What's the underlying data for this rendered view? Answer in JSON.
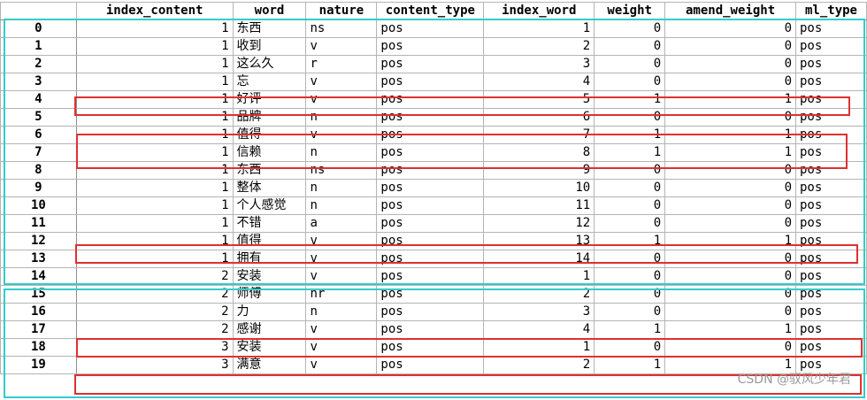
{
  "columns": [
    "index_content",
    "word",
    "nature",
    "content_type",
    "index_word",
    "weight",
    "amend_weight",
    "ml_type"
  ],
  "rows": [
    {
      "idx": "0",
      "index_content": "1",
      "word": "东西",
      "nature": "ns",
      "content_type": "pos",
      "index_word": "1",
      "weight": "0",
      "amend_weight": "0",
      "ml_type": "pos"
    },
    {
      "idx": "1",
      "index_content": "1",
      "word": "收到",
      "nature": "v",
      "content_type": "pos",
      "index_word": "2",
      "weight": "0",
      "amend_weight": "0",
      "ml_type": "pos"
    },
    {
      "idx": "2",
      "index_content": "1",
      "word": "这么久",
      "nature": "r",
      "content_type": "pos",
      "index_word": "3",
      "weight": "0",
      "amend_weight": "0",
      "ml_type": "pos"
    },
    {
      "idx": "3",
      "index_content": "1",
      "word": "忘",
      "nature": "v",
      "content_type": "pos",
      "index_word": "4",
      "weight": "0",
      "amend_weight": "0",
      "ml_type": "pos"
    },
    {
      "idx": "4",
      "index_content": "1",
      "word": "好评",
      "nature": "v",
      "content_type": "pos",
      "index_word": "5",
      "weight": "1",
      "amend_weight": "1",
      "ml_type": "pos"
    },
    {
      "idx": "5",
      "index_content": "1",
      "word": "品牌",
      "nature": "n",
      "content_type": "pos",
      "index_word": "6",
      "weight": "0",
      "amend_weight": "0",
      "ml_type": "pos"
    },
    {
      "idx": "6",
      "index_content": "1",
      "word": "值得",
      "nature": "v",
      "content_type": "pos",
      "index_word": "7",
      "weight": "1",
      "amend_weight": "1",
      "ml_type": "pos"
    },
    {
      "idx": "7",
      "index_content": "1",
      "word": "信赖",
      "nature": "n",
      "content_type": "pos",
      "index_word": "8",
      "weight": "1",
      "amend_weight": "1",
      "ml_type": "pos"
    },
    {
      "idx": "8",
      "index_content": "1",
      "word": "东西",
      "nature": "ns",
      "content_type": "pos",
      "index_word": "9",
      "weight": "0",
      "amend_weight": "0",
      "ml_type": "pos"
    },
    {
      "idx": "9",
      "index_content": "1",
      "word": "整体",
      "nature": "n",
      "content_type": "pos",
      "index_word": "10",
      "weight": "0",
      "amend_weight": "0",
      "ml_type": "pos"
    },
    {
      "idx": "10",
      "index_content": "1",
      "word": "个人感觉",
      "nature": "n",
      "content_type": "pos",
      "index_word": "11",
      "weight": "0",
      "amend_weight": "0",
      "ml_type": "pos"
    },
    {
      "idx": "11",
      "index_content": "1",
      "word": "不错",
      "nature": "a",
      "content_type": "pos",
      "index_word": "12",
      "weight": "0",
      "amend_weight": "0",
      "ml_type": "pos"
    },
    {
      "idx": "12",
      "index_content": "1",
      "word": "值得",
      "nature": "v",
      "content_type": "pos",
      "index_word": "13",
      "weight": "1",
      "amend_weight": "1",
      "ml_type": "pos"
    },
    {
      "idx": "13",
      "index_content": "1",
      "word": "拥有",
      "nature": "v",
      "content_type": "pos",
      "index_word": "14",
      "weight": "0",
      "amend_weight": "0",
      "ml_type": "pos"
    },
    {
      "idx": "14",
      "index_content": "2",
      "word": "安装",
      "nature": "v",
      "content_type": "pos",
      "index_word": "1",
      "weight": "0",
      "amend_weight": "0",
      "ml_type": "pos"
    },
    {
      "idx": "15",
      "index_content": "2",
      "word": "师傅",
      "nature": "nr",
      "content_type": "pos",
      "index_word": "2",
      "weight": "0",
      "amend_weight": "0",
      "ml_type": "pos"
    },
    {
      "idx": "16",
      "index_content": "2",
      "word": "力",
      "nature": "n",
      "content_type": "pos",
      "index_word": "3",
      "weight": "0",
      "amend_weight": "0",
      "ml_type": "pos"
    },
    {
      "idx": "17",
      "index_content": "2",
      "word": "感谢",
      "nature": "v",
      "content_type": "pos",
      "index_word": "4",
      "weight": "1",
      "amend_weight": "1",
      "ml_type": "pos"
    },
    {
      "idx": "18",
      "index_content": "3",
      "word": "安装",
      "nature": "v",
      "content_type": "pos",
      "index_word": "1",
      "weight": "0",
      "amend_weight": "0",
      "ml_type": "pos"
    },
    {
      "idx": "19",
      "index_content": "3",
      "word": "满意",
      "nature": "v",
      "content_type": "pos",
      "index_word": "2",
      "weight": "1",
      "amend_weight": "1",
      "ml_type": "pos"
    }
  ],
  "highlight_colors": {
    "group_box": "#33cccc",
    "weight_box": "#e03030"
  },
  "watermark": "CSDN @驭风少年君"
}
